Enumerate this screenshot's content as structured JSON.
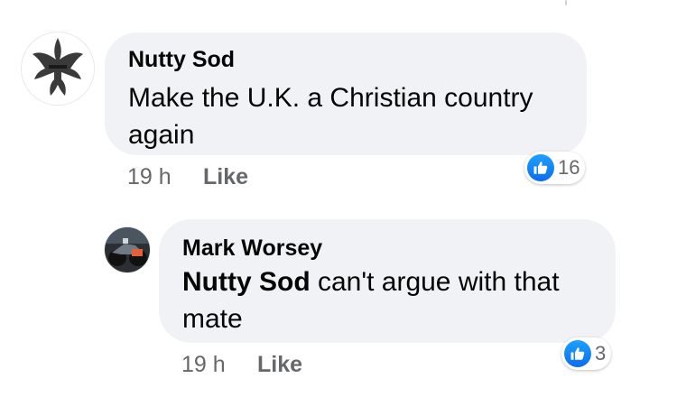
{
  "comments": [
    {
      "author": "Nutty Sod",
      "text": "Make the U.K. a Christian country again",
      "time": "19 h",
      "like_label": "Like",
      "reaction_count": "16",
      "avatar_icon": "fleur-de-lis-icon"
    },
    {
      "author": "Mark Worsey",
      "mention": "Nutty Sod",
      "text": "can't argue with that mate",
      "time": "19 h",
      "like_label": "Like",
      "reaction_count": "3",
      "avatar_icon": "motorcycle-photo"
    }
  ],
  "colors": {
    "bubble": "#f0f2f5",
    "meta_text": "#65676b",
    "like_blue": "#1877f2"
  }
}
